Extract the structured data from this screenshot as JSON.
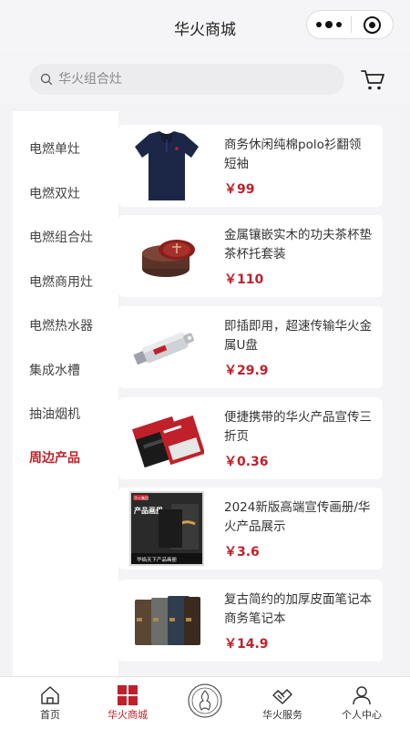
{
  "header": {
    "title": "华火商城"
  },
  "search": {
    "placeholder": "华火组合灶"
  },
  "sidebar": {
    "items": [
      {
        "label": "电燃单灶",
        "active": false
      },
      {
        "label": "电燃双灶",
        "active": false
      },
      {
        "label": "电燃组合灶",
        "active": false
      },
      {
        "label": "电燃商用灶",
        "active": false
      },
      {
        "label": "电燃热水器",
        "active": false
      },
      {
        "label": "集成水槽",
        "active": false
      },
      {
        "label": "抽油烟机",
        "active": false
      },
      {
        "label": "周边产品",
        "active": true
      }
    ]
  },
  "products": [
    {
      "name": "商务休闲纯棉polo衫翻领短袖",
      "price": "￥99",
      "image": "navy-polo-shirt"
    },
    {
      "name": "金属镶嵌实木的功夫茶杯垫茶杯托套装",
      "price": "￥110",
      "image": "tea-coaster-set"
    },
    {
      "name": "即插即用，超速传输华火金属U盘",
      "price": "￥29.9",
      "image": "metal-usb-drive"
    },
    {
      "name": "便捷携带的华火产品宣传三折页",
      "price": "￥0.36",
      "image": "trifold-brochure"
    },
    {
      "name": "2024新版高端宣传画册/华火产品展示",
      "price": "￥3.6",
      "image": "product-album"
    },
    {
      "name": "复古简约的加厚皮面笔记本商务笔记本",
      "price": "￥14.9",
      "image": "leather-notebooks"
    }
  ],
  "thumbs": {
    "album_label": "产品画册",
    "album_banner": "华焰天下产品画册",
    "album_tag": "华火集团"
  },
  "tabs": [
    {
      "label": "首页",
      "icon": "home-icon",
      "active": false
    },
    {
      "label": "华火商城",
      "icon": "grid-icon",
      "active": true
    },
    {
      "label": "",
      "icon": "center-logo-icon",
      "active": false
    },
    {
      "label": "华火服务",
      "icon": "handshake-icon",
      "active": false
    },
    {
      "label": "个人中心",
      "icon": "person-icon",
      "active": false
    }
  ],
  "colors": {
    "accent": "#c0202a",
    "background": "#f3f3f5"
  }
}
